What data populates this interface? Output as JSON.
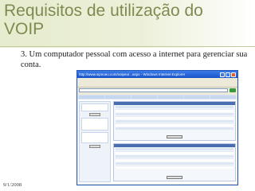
{
  "slide": {
    "title_line1": "Requisitos de utilização do",
    "title_line2": "VOIP",
    "body": "3. Um computador pessoal com acesso a internet para gerenciar sua conta.",
    "date": "9/1/2008"
  },
  "browser": {
    "title": "http://www.sipnoeu.com/voipeu/...aspx - Windows Internet Explorer"
  },
  "colors": {
    "title": "#7f8a51",
    "header_band": "#e6ecce",
    "window_frame": "#2456b8"
  }
}
